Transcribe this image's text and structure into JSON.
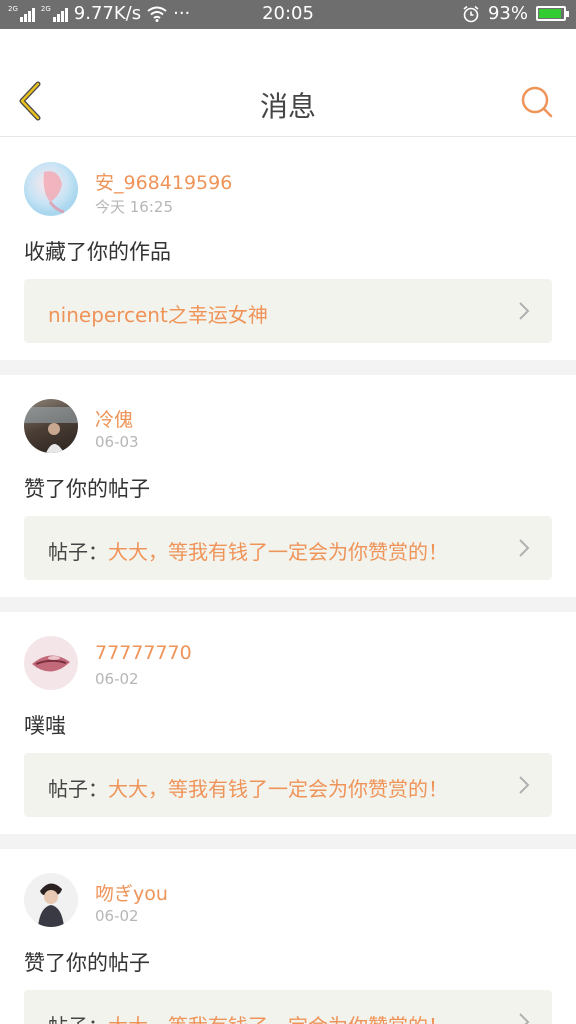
{
  "status_bar": {
    "signal1_label": "2G",
    "signal2_label": "2G",
    "net_speed": "9.77K/s",
    "more": "···",
    "time": "20:05",
    "battery_pct": "93%"
  },
  "header": {
    "title": "消息",
    "back_icon": "chevron-left-icon",
    "search_icon": "search-icon"
  },
  "colors": {
    "accent": "#ef9459",
    "back_icon": "#e8a820",
    "ref_bg": "#f3f3ee"
  },
  "messages": [
    {
      "username": "安_968419596",
      "time": "今天 16:25",
      "action": "收藏了你的作品",
      "ref_prefix": "",
      "ref_text": "ninepercent之幸运女神"
    },
    {
      "username": "冷傀",
      "time": "06-03",
      "action": "赞了你的帖子",
      "ref_prefix": "帖子：",
      "ref_text": "大大，等我有钱了一定会为你赞赏的！"
    },
    {
      "username": "77777770",
      "time": "06-02",
      "action": "噗嗤",
      "ref_prefix": "帖子：",
      "ref_text": "大大，等我有钱了一定会为你赞赏的！"
    },
    {
      "username": "吻ぎyou",
      "time": "06-02",
      "action": "赞了你的帖子",
      "ref_prefix": "帖子：",
      "ref_text": "大大，等我有钱了一定会为你赞赏的！"
    }
  ]
}
